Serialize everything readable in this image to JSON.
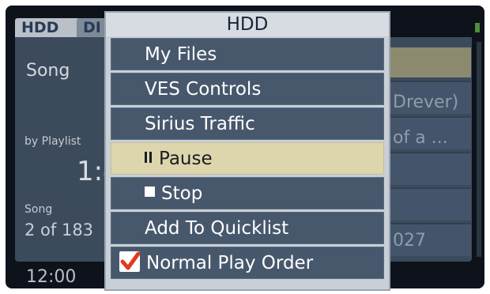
{
  "background": {
    "tabs": [
      "HDD",
      "DI"
    ],
    "song_label": "Song",
    "by_playlist_label": "by Playlist",
    "time": "1:4",
    "song_small_label": "Song",
    "track_count": "2 of 183",
    "clock": "12:00",
    "right_text_1": "Drever)",
    "right_text_2": "of a ...",
    "right_text_3": "027"
  },
  "menu": {
    "title": "HDD",
    "items": [
      {
        "label": "My Files",
        "selected": false
      },
      {
        "label": "VES Controls",
        "selected": false
      },
      {
        "label": "Sirius Traffic",
        "selected": false
      },
      {
        "label": "Pause",
        "icon": "pause-icon",
        "selected": true
      },
      {
        "label": "Stop",
        "icon": "stop-icon",
        "selected": false
      },
      {
        "label": "Add To Quicklist",
        "selected": false
      },
      {
        "label": "Normal Play Order",
        "icon": "checkmark-icon",
        "checked": true,
        "selected": false
      }
    ]
  },
  "colors": {
    "menu_item_bg": "#47586d",
    "selected_bg": "#ddd6ad",
    "checkmark": "#e03a1e",
    "screen_bg": "#0d121b"
  }
}
